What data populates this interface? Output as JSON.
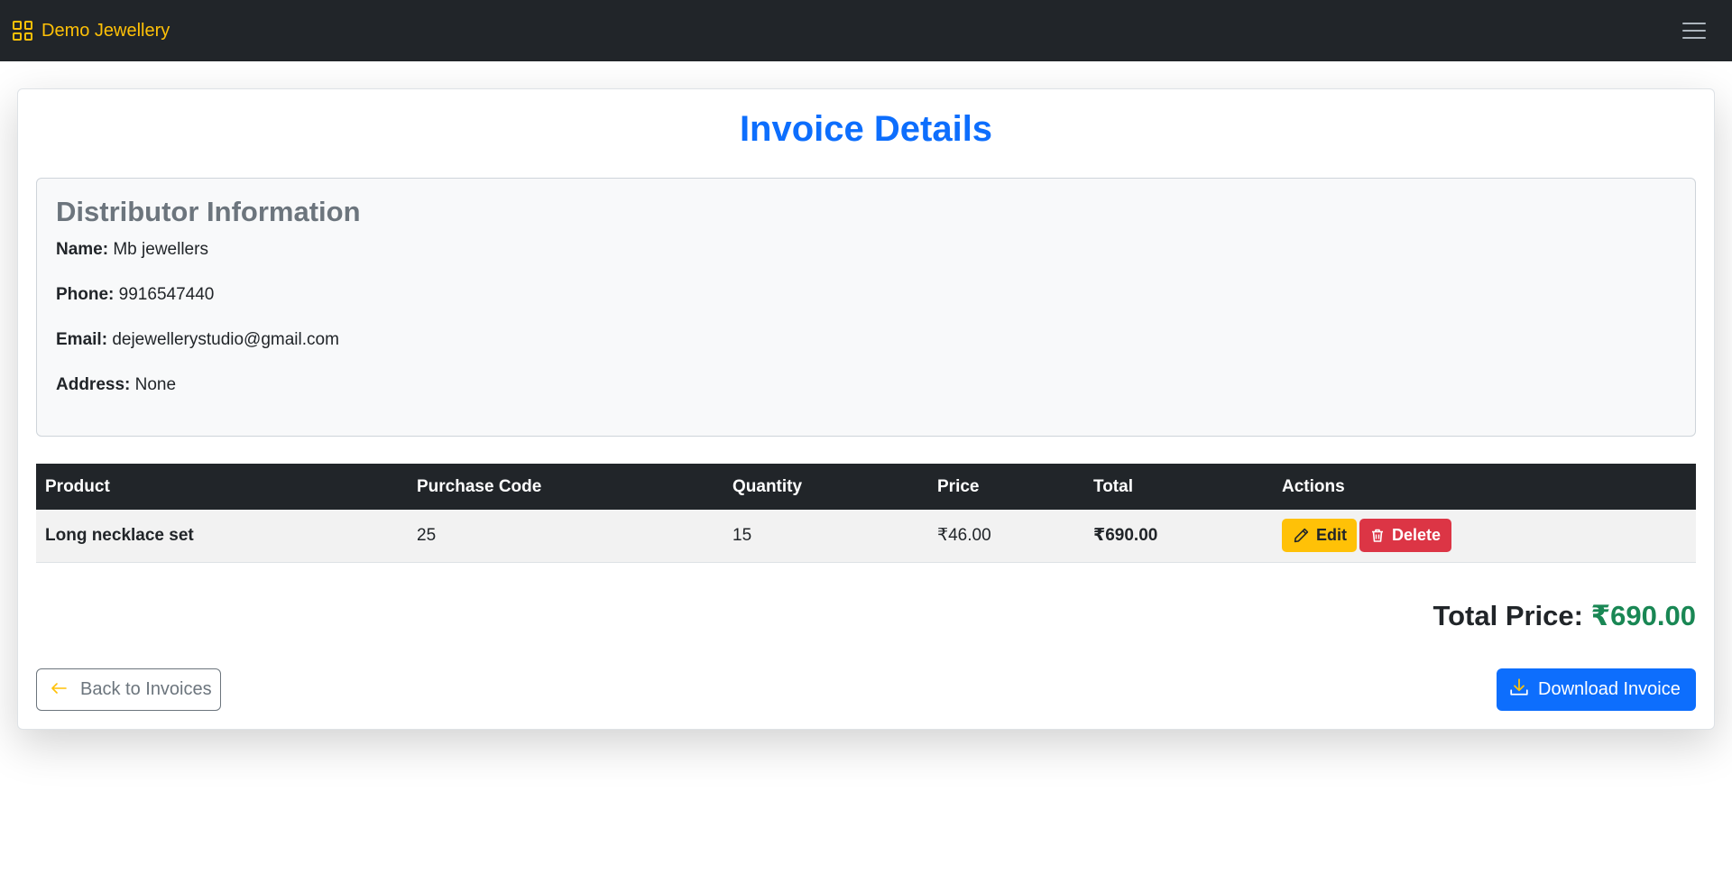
{
  "navbar": {
    "brand": "Demo Jewellery",
    "brand_icon": "dashboard-grid-icon",
    "toggler_icon": "hamburger-menu-icon"
  },
  "page": {
    "title": "Invoice Details"
  },
  "distributor": {
    "heading": "Distributor Information",
    "name_label": "Name:",
    "name": "Mb jewellers",
    "phone_label": "Phone:",
    "phone": "9916547440",
    "email_label": "Email:",
    "email": "dejewellerystudio@gmail.com",
    "address_label": "Address:",
    "address": "None"
  },
  "table": {
    "headers": [
      "Product",
      "Purchase Code",
      "Quantity",
      "Price",
      "Total",
      "Actions"
    ],
    "rows": [
      {
        "product": "Long necklace set",
        "purchase_code": "25",
        "quantity": "15",
        "price": "₹46.00",
        "total": "₹690.00",
        "edit_label": "Edit",
        "delete_label": "Delete"
      }
    ]
  },
  "summary": {
    "total_label": "Total Price:",
    "total_value": "₹690.00"
  },
  "actions": {
    "back_label": "Back to Invoices",
    "download_label": "Download Invoice"
  },
  "colors": {
    "navbar_bg": "#212529",
    "brand": "#ffc107",
    "title": "#0d6efd",
    "edit": "#ffc107",
    "delete": "#dc3545",
    "total_amount": "#198754",
    "download": "#0d6efd"
  }
}
